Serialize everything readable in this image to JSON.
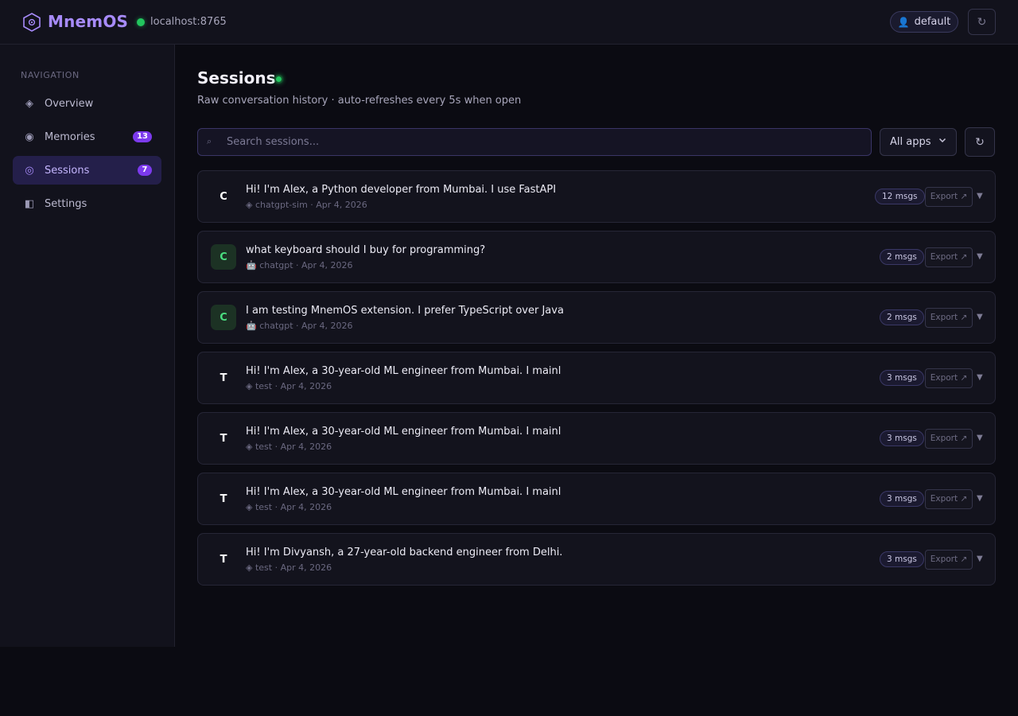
{
  "app": {
    "name": "MnemOS",
    "host": "localhost:8765",
    "user": "default",
    "colors": {
      "accent": "#a78bfa",
      "online": "#22c55e",
      "badge": "#7c3aed"
    }
  },
  "sidebar": {
    "heading": "NAVIGATION",
    "items": [
      {
        "label": "Overview",
        "icon": "diamond-icon",
        "badge": ""
      },
      {
        "label": "Memories",
        "icon": "circle-dot-icon",
        "badge": "13"
      },
      {
        "label": "Sessions",
        "icon": "target-icon",
        "badge": "7",
        "active": true
      },
      {
        "label": "Settings",
        "icon": "half-square-icon",
        "badge": ""
      }
    ]
  },
  "main": {
    "title": "Sessions",
    "subtitle": "Raw conversation history · auto-refreshes every 5s when open",
    "search_placeholder": "Search sessions...",
    "app_filter": "All apps",
    "export_label": "Export ↗",
    "sessions": [
      {
        "avatar": "C",
        "title": "Hi! I'm Alex, a Python developer from Mumbai. I use FastAPI",
        "meta": "◈ chatgpt-sim · Apr 4, 2026",
        "msgs": "12 msgs"
      },
      {
        "avatar": "C",
        "title": "what keyboard should I buy for programming?",
        "meta": "🤖 chatgpt · Apr 4, 2026",
        "msgs": "2 msgs"
      },
      {
        "avatar": "C",
        "title": "I am testing MnemOS extension. I prefer TypeScript over Java",
        "meta": "🤖 chatgpt · Apr 4, 2026",
        "msgs": "2 msgs"
      },
      {
        "avatar": "T",
        "title": "Hi! I'm Alex, a 30-year-old ML engineer from Mumbai. I mainl",
        "meta": "◈ test · Apr 4, 2026",
        "msgs": "3 msgs"
      },
      {
        "avatar": "T",
        "title": "Hi! I'm Alex, a 30-year-old ML engineer from Mumbai. I mainl",
        "meta": "◈ test · Apr 4, 2026",
        "msgs": "3 msgs"
      },
      {
        "avatar": "T",
        "title": "Hi! I'm Alex, a 30-year-old ML engineer from Mumbai. I mainl",
        "meta": "◈ test · Apr 4, 2026",
        "msgs": "3 msgs"
      },
      {
        "avatar": "T",
        "title": "Hi! I'm Divyansh, a 27-year-old backend engineer from Delhi.",
        "meta": "◈ test · Apr 4, 2026",
        "msgs": "3 msgs"
      }
    ]
  }
}
